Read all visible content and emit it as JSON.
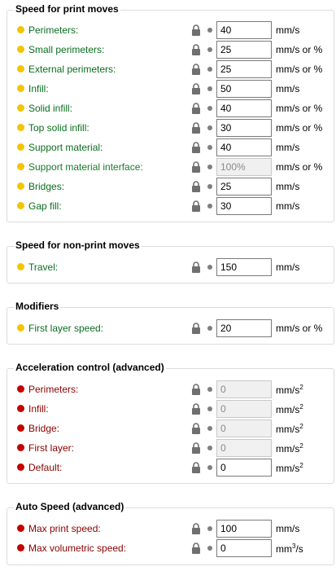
{
  "sections": {
    "print_moves": {
      "title": "Speed for print moves",
      "rows": [
        {
          "label": "Perimeters:",
          "value": "40",
          "unit": "mm/s"
        },
        {
          "label": "Small perimeters:",
          "value": "25",
          "unit": "mm/s or %"
        },
        {
          "label": "External perimeters:",
          "value": "25",
          "unit": "mm/s or %"
        },
        {
          "label": "Infill:",
          "value": "50",
          "unit": "mm/s"
        },
        {
          "label": "Solid infill:",
          "value": "40",
          "unit": "mm/s or %"
        },
        {
          "label": "Top solid infill:",
          "value": "30",
          "unit": "mm/s or %"
        },
        {
          "label": "Support material:",
          "value": "40",
          "unit": "mm/s"
        },
        {
          "label": "Support material interface:",
          "value": "100%",
          "unit": "mm/s or %"
        },
        {
          "label": "Bridges:",
          "value": "25",
          "unit": "mm/s"
        },
        {
          "label": "Gap fill:",
          "value": "30",
          "unit": "mm/s"
        }
      ]
    },
    "non_print_moves": {
      "title": "Speed for non-print moves",
      "rows": [
        {
          "label": "Travel:",
          "value": "150",
          "unit": "mm/s"
        }
      ]
    },
    "modifiers": {
      "title": "Modifiers",
      "rows": [
        {
          "label": "First layer speed:",
          "value": "20",
          "unit": "mm/s or %"
        }
      ]
    },
    "acceleration": {
      "title": "Acceleration control (advanced)",
      "unit_base": "mm/s",
      "unit_exp": "2",
      "rows": [
        {
          "label": "Perimeters:",
          "value": "0"
        },
        {
          "label": "Infill:",
          "value": "0"
        },
        {
          "label": "Bridge:",
          "value": "0"
        },
        {
          "label": "First layer:",
          "value": "0"
        },
        {
          "label": "Default:",
          "value": "0"
        }
      ]
    },
    "auto_speed": {
      "title": "Auto Speed (advanced)",
      "rows": [
        {
          "label": "Max print speed:",
          "value": "100",
          "unit": "mm/s"
        },
        {
          "label": "Max volumetric speed:",
          "value": "0",
          "unit_base": "mm",
          "unit_exp": "3",
          "unit_suffix": "/s"
        }
      ]
    }
  },
  "colors": {
    "simple_mode_dot": "#f2c500",
    "advanced_mode_dot": "#c40000",
    "label_green": "#0a6e1f",
    "label_red": "#8b0000"
  },
  "icons": {
    "lock": "lock-icon",
    "bullet": "bullet-dot-icon"
  }
}
